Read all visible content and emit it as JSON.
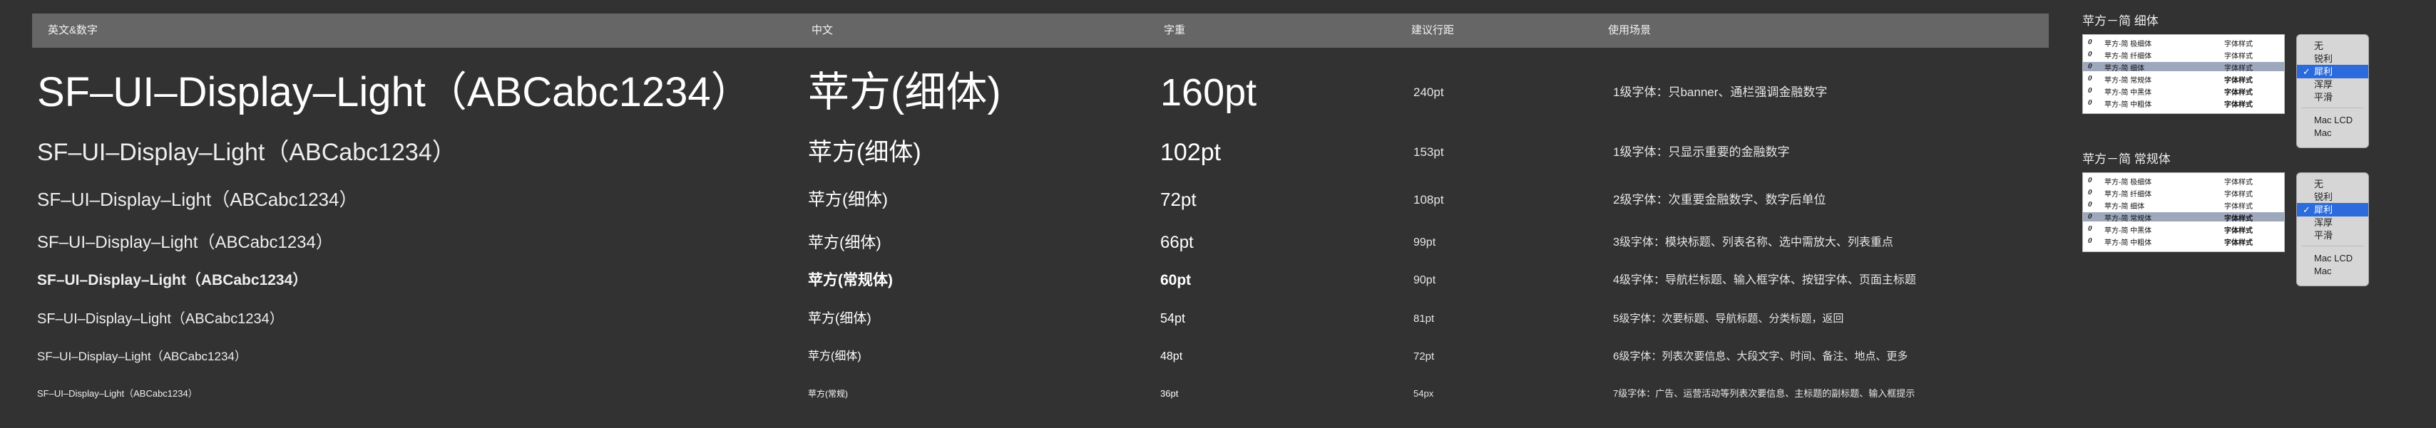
{
  "table": {
    "headers": {
      "en_num": "英文&数字",
      "cn": "中文",
      "weight": "字重",
      "line_height": "建议行距",
      "usage": "使用场景"
    },
    "rows": [
      {
        "en": "SF–UI–Display–Light（ABCabc1234）",
        "cn": "苹方(细体)",
        "size": "160pt",
        "lh": "240pt",
        "usage": "1级字体：只banner、通栏强调金融数字"
      },
      {
        "en": "SF–UI–Display–Light（ABCabc1234）",
        "cn": "苹方(细体)",
        "size": "102pt",
        "lh": "153pt",
        "usage": "1级字体：只显示重要的金融数字"
      },
      {
        "en": "SF–UI–Display–Light（ABCabc1234）",
        "cn": "苹方(细体)",
        "size": "72pt",
        "lh": "108pt",
        "usage": "2级字体：次重要金融数字、数字后单位"
      },
      {
        "en": "SF–UI–Display–Light（ABCabc1234）",
        "cn": "苹方(细体)",
        "size": "66pt",
        "lh": "99pt",
        "usage": "3级字体：模块标题、列表名称、选中需放大、列表重点"
      },
      {
        "en": "SF–UI–Display–Light（ABCabc1234）",
        "cn": "苹方(常规体)",
        "size": "60pt",
        "lh": "90pt",
        "usage": "4级字体：导航栏标题、输入框字体、按钮字体、页面主标题"
      },
      {
        "en": "SF–UI–Display–Light（ABCabc1234）",
        "cn": "苹方(细体)",
        "size": "54pt",
        "lh": "81pt",
        "usage": "5级字体：次要标题、导航标题、分类标题，返回"
      },
      {
        "en": "SF–UI–Display–Light（ABCabc1234）",
        "cn": "苹方(细体)",
        "size": "48pt",
        "lh": "72pt",
        "usage": "6级字体：列表次要信息、大段文字、时间、备注、地点、更多"
      },
      {
        "en": "SF–UI–Display–Light（ABCabc1234）",
        "cn": "苹方(常规)",
        "size": "36pt",
        "lh": "54px",
        "usage": "7级字体：广告、运营活动等列表次要信息、主标题的副标题、输入框提示"
      }
    ]
  },
  "groups": [
    {
      "title": "苹方－简 细体",
      "preview_lines": [
        {
          "icon": "0",
          "name": "苹方-简 极细体",
          "style": "字体样式"
        },
        {
          "icon": "0",
          "name": "苹方-简 纤细体",
          "style": "字体样式"
        },
        {
          "icon": "0",
          "name": "苹方-简 细体",
          "style": "字体样式"
        },
        {
          "icon": "0",
          "name": "苹方-简 常规体",
          "style": "字体样式"
        },
        {
          "icon": "0",
          "name": "苹方-简 中黑体",
          "style": "字体样式"
        },
        {
          "icon": "0",
          "name": "苹方-简 中粗体",
          "style": "字体样式"
        }
      ],
      "selected_line": 2,
      "menu": [
        "无",
        "锐利",
        "犀利",
        "浑厚",
        "平滑",
        "Mac LCD",
        "Mac"
      ],
      "menu_checked": 2
    },
    {
      "title": "苹方－简 常规体",
      "preview_lines": [
        {
          "icon": "0",
          "name": "苹方-简 极细体",
          "style": "字体样式"
        },
        {
          "icon": "0",
          "name": "苹方-简 纤细体",
          "style": "字体样式"
        },
        {
          "icon": "0",
          "name": "苹方-简 细体",
          "style": "字体样式"
        },
        {
          "icon": "0",
          "name": "苹方-简 常规体",
          "style": "字体样式"
        },
        {
          "icon": "0",
          "name": "苹方-简 中黑体",
          "style": "字体样式"
        },
        {
          "icon": "0",
          "name": "苹方-简 中粗体",
          "style": "字体样式"
        }
      ],
      "selected_line": 3,
      "menu": [
        "无",
        "锐利",
        "犀利",
        "浑厚",
        "平滑",
        "Mac LCD",
        "Mac"
      ],
      "menu_checked": 2
    }
  ],
  "colors": {
    "background": "#323232",
    "header_bg": "#666666",
    "menu_highlight": "#2b6bdc",
    "preview_selected": "#9ea8bd"
  }
}
